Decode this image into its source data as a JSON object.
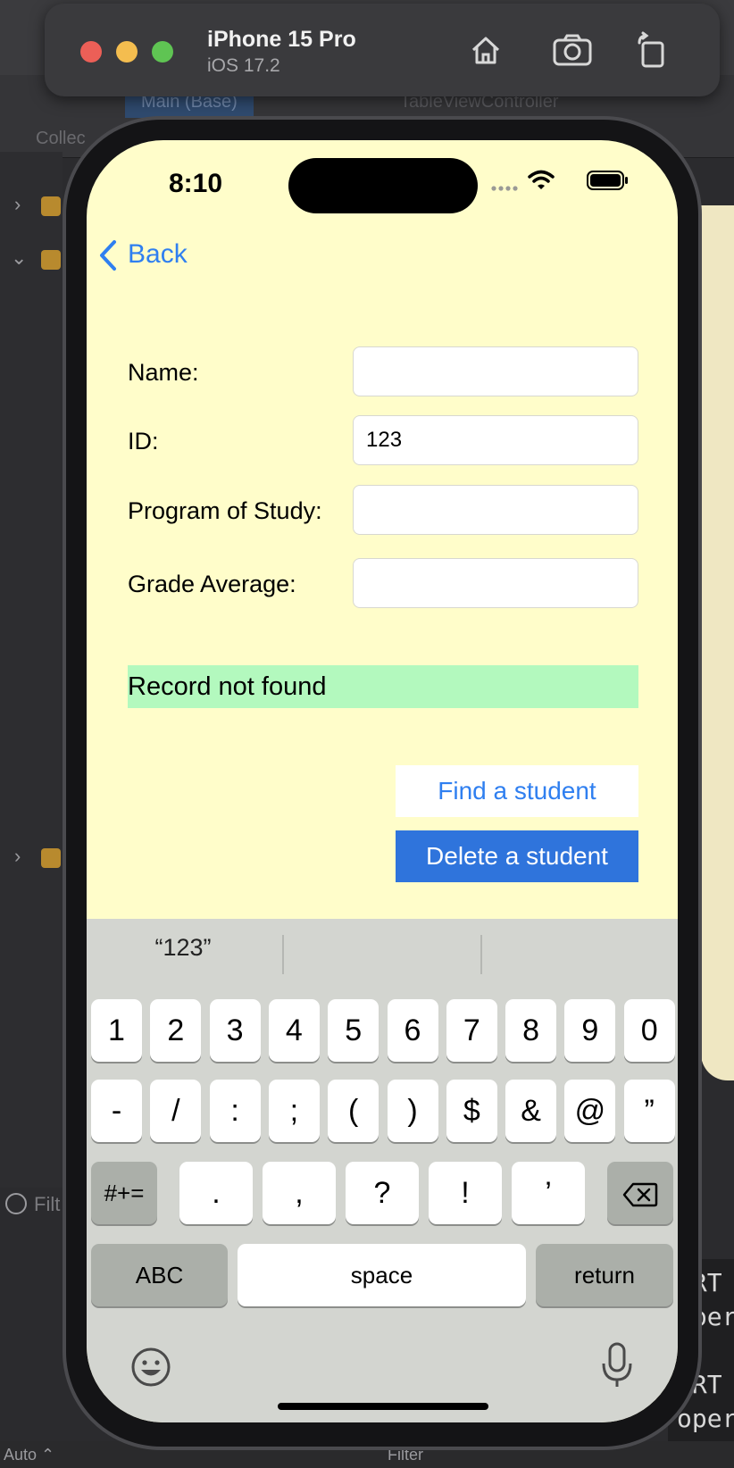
{
  "simulator": {
    "device": "iPhone 15 Pro",
    "os": "iOS 17.2",
    "colors": {
      "close": "#ec5f57",
      "minimize": "#f4bd4f",
      "zoom": "#5fc453"
    }
  },
  "backdrop": {
    "tab_main": "Main (Base)",
    "tab_table": "TableViewController",
    "side_label": "Collec",
    "filter": "Filter",
    "filter_left": "Filt",
    "auto_label": "Auto ⌃",
    "console_lines": [
      "[RT",
      "oper",
      "[RT",
      "oper"
    ]
  },
  "status_bar": {
    "time": "8:10"
  },
  "nav": {
    "back_label": "Back"
  },
  "form": {
    "name_label": "Name:",
    "name_value": "",
    "id_label": "ID:",
    "id_value": "123",
    "program_label": "Program of Study:",
    "program_value": "",
    "grade_label": "Grade Average:",
    "grade_value": ""
  },
  "status_message": "Record not found",
  "buttons": {
    "find": "Find a student",
    "delete": "Delete a student"
  },
  "keyboard": {
    "suggestion": "“123”",
    "row1": [
      "1",
      "2",
      "3",
      "4",
      "5",
      "6",
      "7",
      "8",
      "9",
      "0"
    ],
    "row2": [
      "-",
      "/",
      ":",
      ";",
      "(",
      ")",
      "$",
      "&",
      "@",
      "”"
    ],
    "row3_shift": "#+=",
    "row3": [
      ".",
      ",",
      "?",
      "!",
      "’"
    ],
    "abc": "ABC",
    "space": "space",
    "return": "return"
  },
  "colors": {
    "screen_bg": "#fffdca",
    "accent": "#2f7ff0",
    "status_bg": "#b3f9be"
  }
}
